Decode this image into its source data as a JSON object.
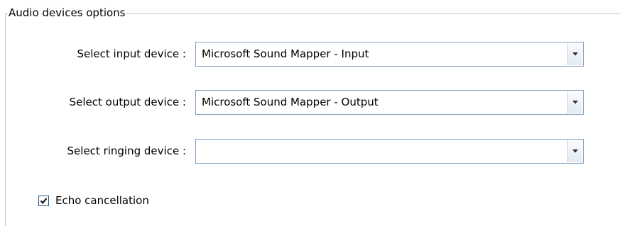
{
  "group": {
    "title": "Audio devices options"
  },
  "input_device": {
    "label": "Select input device :",
    "value": "Microsoft Sound Mapper - Input"
  },
  "output_device": {
    "label": "Select output device :",
    "value": "Microsoft Sound Mapper - Output"
  },
  "ringing_device": {
    "label": "Select ringing device :",
    "value": ""
  },
  "echo_cancellation": {
    "label": "Echo cancellation",
    "checked": true
  },
  "icons": {
    "dropdown": "chevron-down-icon",
    "check": "check-icon"
  },
  "colors": {
    "groupbox_border": "#bcc7d8",
    "combo_border": "#7f9db9",
    "checkbox_border": "#1c5180"
  }
}
